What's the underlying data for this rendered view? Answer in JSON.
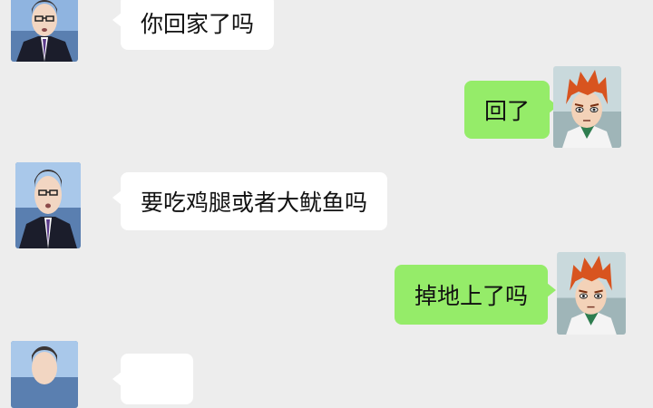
{
  "chat": {
    "messages": [
      {
        "sender": "left-user",
        "text": "你回家了吗"
      },
      {
        "sender": "right-user",
        "text": "回了"
      },
      {
        "sender": "left-user",
        "text": "要吃鸡腿或者大鱿鱼吗"
      },
      {
        "sender": "right-user",
        "text": "掉地上了吗"
      },
      {
        "sender": "left-user",
        "text": ""
      }
    ]
  },
  "colors": {
    "background": "#ededed",
    "left_bubble": "#ffffff",
    "right_bubble": "#95ec69"
  },
  "icons": {
    "left_avatar": "suited-man-avatar-icon",
    "right_avatar": "red-haired-boy-avatar-icon"
  }
}
